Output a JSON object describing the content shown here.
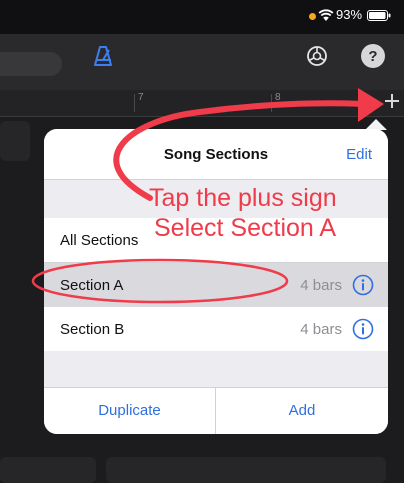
{
  "status_bar": {
    "battery": "93%",
    "dot_color": "#f5a623"
  },
  "toolbar": {
    "icons": [
      "metronome-icon",
      "settings-icon",
      "help-icon"
    ],
    "help_glyph": "?"
  },
  "ruler": {
    "marks": [
      "7",
      "8"
    ],
    "add_glyph": "+"
  },
  "popover": {
    "title": "Song Sections",
    "edit_label": "Edit",
    "rows": [
      {
        "label": "All Sections"
      },
      {
        "label": "Section A",
        "bars": "4 bars",
        "selected": true
      },
      {
        "label": "Section B",
        "bars": "4 bars"
      }
    ],
    "duplicate_label": "Duplicate",
    "add_label": "Add"
  },
  "annotation": {
    "line1": "Tap the plus sign",
    "line2": "Select Section A",
    "color": "#ef3b4a"
  },
  "colors": {
    "accent": "#2f6fe0",
    "toolbar": "#2a2a2c",
    "popover": "#f2f2f7"
  }
}
